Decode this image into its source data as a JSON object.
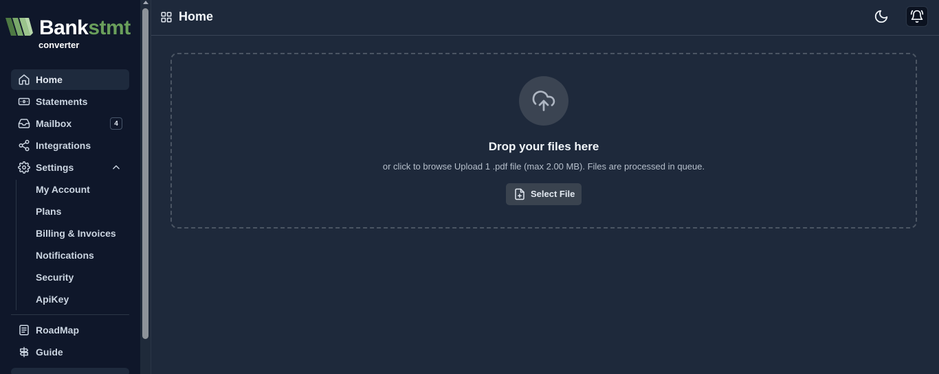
{
  "brand": {
    "name_part1": "Bank",
    "name_part2": "stmt",
    "subtitle": "converter",
    "accent": "#6a9f5b"
  },
  "sidebar": {
    "items": [
      {
        "label": "Home",
        "icon": "home-icon",
        "active": true
      },
      {
        "label": "Statements",
        "icon": "banknote-icon"
      },
      {
        "label": "Mailbox",
        "icon": "inbox-icon",
        "badge": "4"
      },
      {
        "label": "Integrations",
        "icon": "share-icon"
      },
      {
        "label": "Settings",
        "icon": "gear-icon",
        "expanded": true
      }
    ],
    "settings_children": [
      "My Account",
      "Plans",
      "Billing & Invoices",
      "Notifications",
      "Security",
      "ApiKey"
    ],
    "bottom_items": [
      {
        "label": "RoadMap",
        "icon": "document-icon"
      },
      {
        "label": "Guide",
        "icon": "signpost-icon"
      }
    ]
  },
  "header": {
    "title": "Home",
    "icon": "grid-icon"
  },
  "upload": {
    "title": "Drop your files here",
    "hint": "or click to browse Upload 1 .pdf file (max 2.00 MB). Files are processed in queue.",
    "button_label": "Select File"
  }
}
